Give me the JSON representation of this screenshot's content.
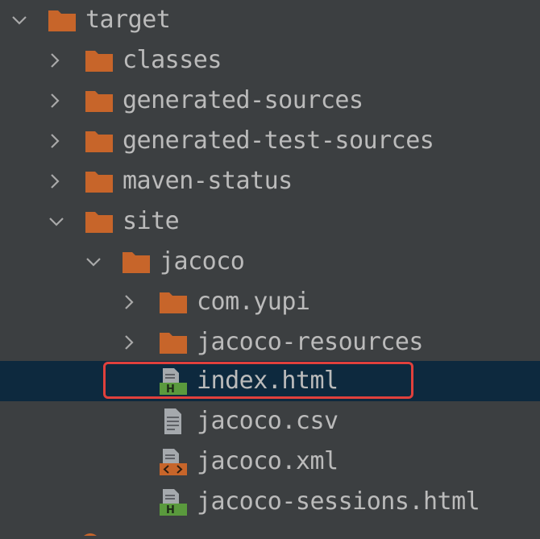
{
  "tree": {
    "items": [
      {
        "label": "target",
        "type": "folder",
        "expanded": true,
        "icon": "folder-icon"
      },
      {
        "label": "classes",
        "type": "folder",
        "expanded": false,
        "icon": "folder-icon"
      },
      {
        "label": "generated-sources",
        "type": "folder",
        "expanded": false,
        "icon": "folder-icon"
      },
      {
        "label": "generated-test-sources",
        "type": "folder",
        "expanded": false,
        "icon": "folder-icon"
      },
      {
        "label": "maven-status",
        "type": "folder",
        "expanded": false,
        "icon": "folder-icon"
      },
      {
        "label": "site",
        "type": "folder",
        "expanded": true,
        "icon": "folder-icon"
      },
      {
        "label": "jacoco",
        "type": "folder",
        "expanded": true,
        "icon": "folder-icon"
      },
      {
        "label": "com.yupi",
        "type": "folder",
        "expanded": false,
        "icon": "folder-icon"
      },
      {
        "label": "jacoco-resources",
        "type": "folder",
        "expanded": false,
        "icon": "folder-icon"
      },
      {
        "label": "index.html",
        "type": "file",
        "selected": true,
        "icon": "html-file-icon"
      },
      {
        "label": "jacoco.csv",
        "type": "file",
        "icon": "text-file-icon"
      },
      {
        "label": "jacoco.xml",
        "type": "file",
        "icon": "xml-file-icon"
      },
      {
        "label": "jacoco-sessions.html",
        "type": "file",
        "icon": "html-file-icon"
      }
    ]
  },
  "colors": {
    "background": "#3c3f41",
    "selection": "#0d293e",
    "folder": "#c7652a",
    "html_badge": "#5a9a3d",
    "xml_badge": "#c7652a",
    "text": "#bbbbbb",
    "highlight_border": "#e0403c"
  }
}
